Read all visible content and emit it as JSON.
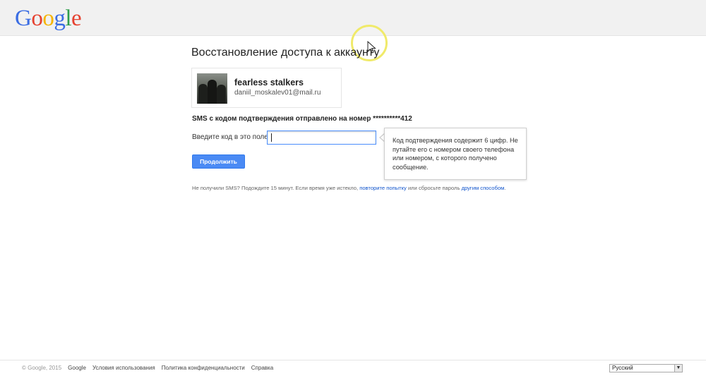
{
  "header": {
    "logo": [
      {
        "letter": "G",
        "color": "#3b6de3"
      },
      {
        "letter": "o",
        "color": "#e5412f"
      },
      {
        "letter": "o",
        "color": "#f5b400"
      },
      {
        "letter": "g",
        "color": "#3b6de3"
      },
      {
        "letter": "l",
        "color": "#2e9d4b"
      },
      {
        "letter": "e",
        "color": "#e5412f"
      }
    ]
  },
  "main": {
    "title": "Восстановление доступа к аккаунту",
    "account": {
      "name": "fearless stalkers",
      "email": "daniil_moskalev01@mail.ru"
    },
    "sms_info": "SMS с кодом подтверждения отправлено на номер **********412",
    "code_label": "Введите код в это поле",
    "code_value": "",
    "tooltip": "Код подтверждения содержит 6 цифр. Не путайте его с номером своего телефона или номером, с которого получено сообщение.",
    "continue_label": "Продолжить",
    "help": {
      "prefix": "Не получили SMS? Подождите 15 минут. Если время уже истекло, ",
      "retry_link": "повторите попытку",
      "middle": " или сбросьте пароль ",
      "other_link": "другим способом",
      "suffix": "."
    }
  },
  "footer": {
    "copyright": "© Google, 2015",
    "links": [
      "Google",
      "Условия использования",
      "Политика конфиденциальности",
      "Справка"
    ],
    "language": "Русский"
  },
  "icons": {
    "cursor": "mouse-pointer-icon",
    "dropdown": "chevron-down-icon"
  },
  "colors": {
    "primary_button": "#4a8af4",
    "link": "#1155cc",
    "input_focus": "#4d90fe",
    "topbar": "#f1f1f1"
  }
}
